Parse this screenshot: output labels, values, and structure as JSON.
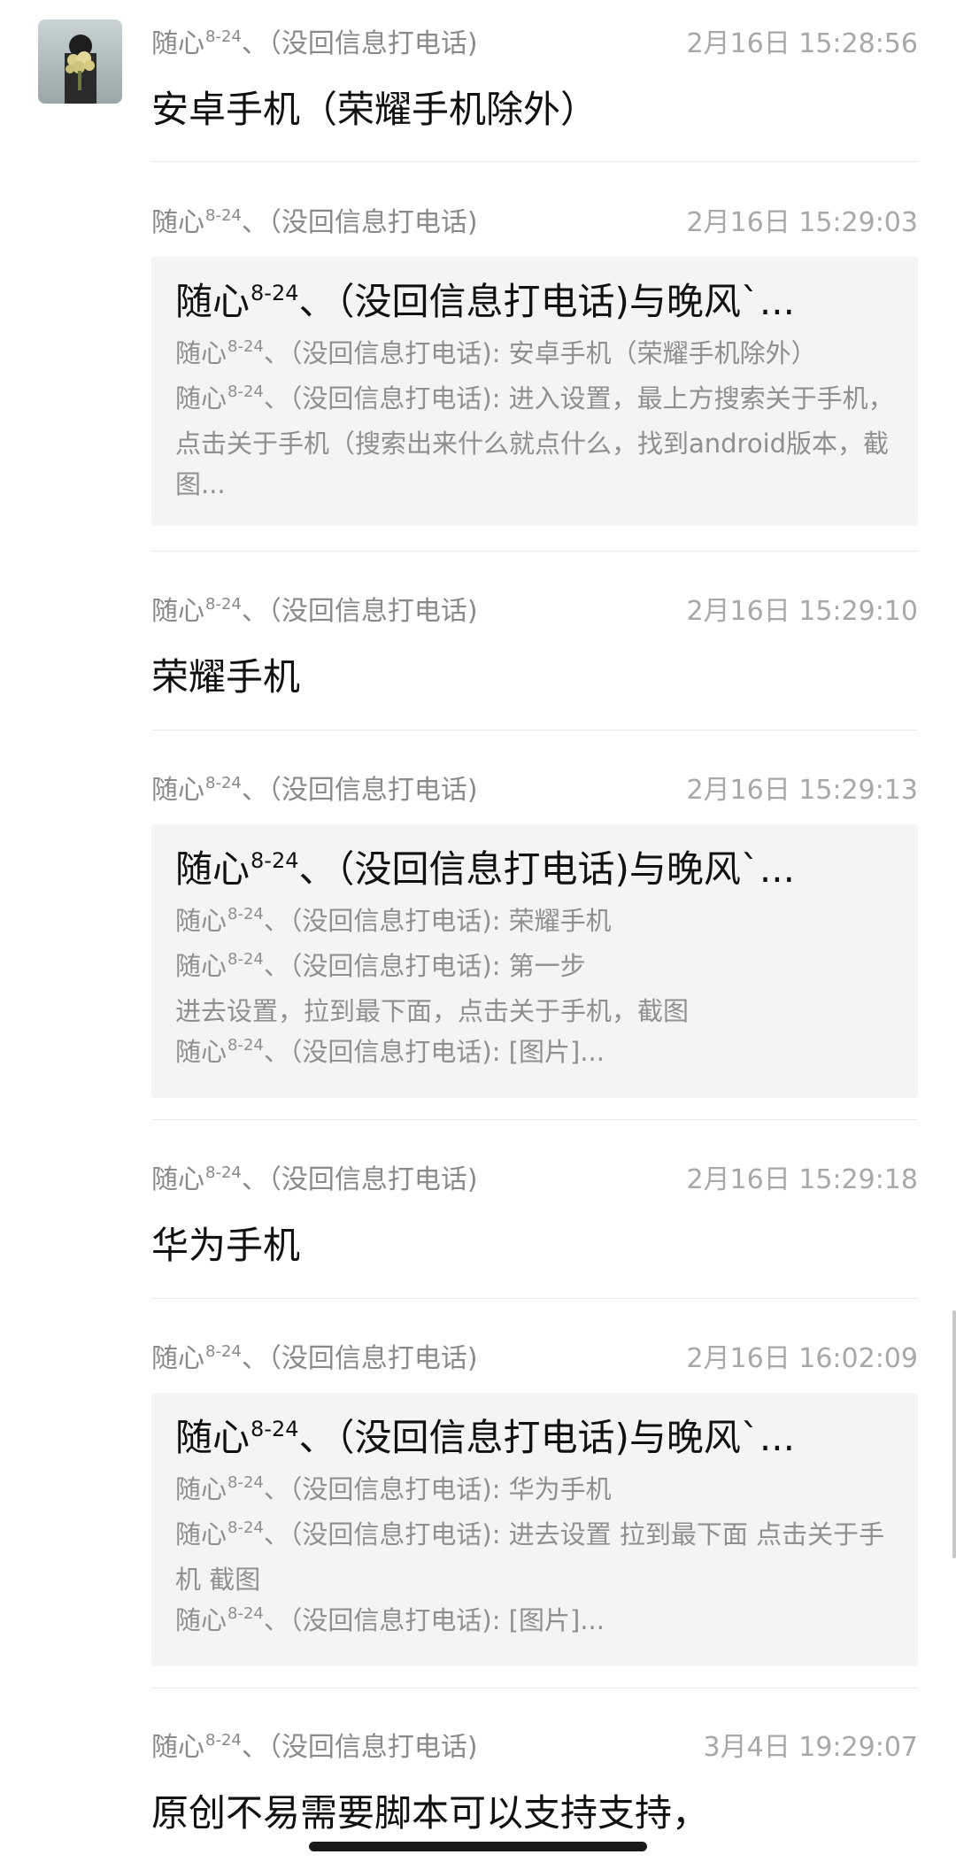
{
  "sender": {
    "name": "随心",
    "sup": "8-24",
    "suffix": "、（没回信息打电话)"
  },
  "messages": [
    {
      "time": "2月16日 15:28:56",
      "text": "安卓手机（荣耀手机除外）"
    },
    {
      "time": "2月16日 15:29:03",
      "card": {
        "title_name": "随心",
        "title_sup": "8-24",
        "title_rest": "、（没回信息打电话)与晚风`...",
        "lines": [
          {
            "prefix": "随心",
            "sup": "8-24",
            "text": "、（没回信息打电话): 安卓手机（荣耀手机除外）"
          },
          {
            "prefix": "随心",
            "sup": "8-24",
            "text": "、（没回信息打电话): 进入设置，最上方搜索关于手机，点击关于手机（搜索出来什么就点什么，找到android版本，截图..."
          }
        ]
      }
    },
    {
      "time": "2月16日 15:29:10",
      "text": "荣耀手机"
    },
    {
      "time": "2月16日 15:29:13",
      "card": {
        "title_name": "随心",
        "title_sup": "8-24",
        "title_rest": "、（没回信息打电话)与晚风`...",
        "lines": [
          {
            "prefix": "随心",
            "sup": "8-24",
            "text": "、（没回信息打电话): 荣耀手机"
          },
          {
            "prefix": "随心",
            "sup": "8-24",
            "text": "、（没回信息打电话): 第一步"
          },
          {
            "prefix": "",
            "sup": "",
            "text": "进去设置，拉到最下面，点击关于手机，截图"
          },
          {
            "prefix": "随心",
            "sup": "8-24",
            "text": "、（没回信息打电话): [图片]..."
          }
        ]
      }
    },
    {
      "time": "2月16日 15:29:18",
      "text": "华为手机"
    },
    {
      "time": "2月16日 16:02:09",
      "card": {
        "title_name": "随心",
        "title_sup": "8-24",
        "title_rest": "、（没回信息打电话)与晚风`...",
        "lines": [
          {
            "prefix": "随心",
            "sup": "8-24",
            "text": "、（没回信息打电话): 华为手机"
          },
          {
            "prefix": "随心",
            "sup": "8-24",
            "text": "、（没回信息打电话): 进去设置 拉到最下面 点击关于手机 截图"
          },
          {
            "prefix": "随心",
            "sup": "8-24",
            "text": "、（没回信息打电话): [图片]..."
          }
        ]
      }
    },
    {
      "time": "3月4日 19:29:07",
      "text": "原创不易需要脚本可以支持支持，"
    }
  ]
}
